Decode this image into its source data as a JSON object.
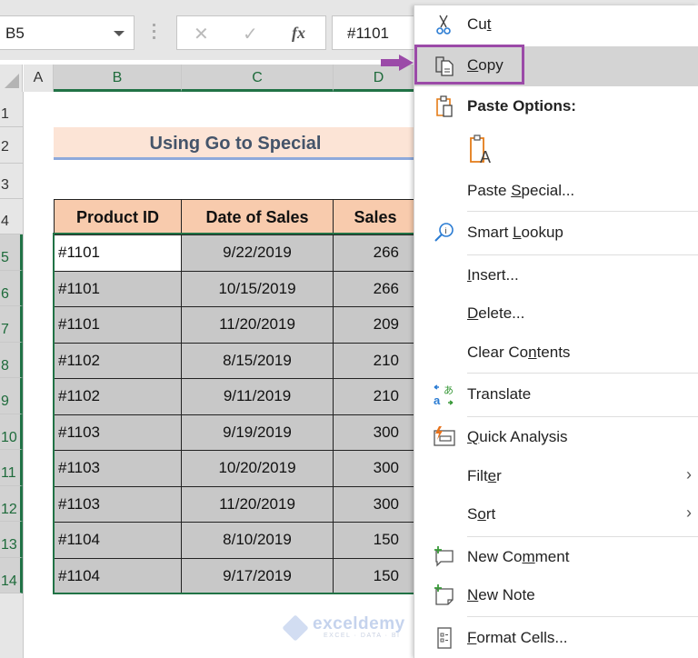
{
  "formula_bar": {
    "name_box": "B5",
    "cancel_icon": "✕",
    "enter_icon": "✓",
    "fx_label": "fx",
    "formula_value": "#1101"
  },
  "columns": [
    "A",
    "B",
    "C",
    "D"
  ],
  "rows": [
    "1",
    "2",
    "3",
    "4",
    "5",
    "6",
    "7",
    "8",
    "9",
    "10",
    "11",
    "12",
    "13",
    "14"
  ],
  "sheet": {
    "title": "Using Go to Special",
    "headers": [
      "Product ID",
      "Date of Sales",
      "Sales"
    ],
    "records": [
      {
        "id": "#1101",
        "date": "9/22/2019",
        "sales": "266"
      },
      {
        "id": "#1101",
        "date": "10/15/2019",
        "sales": "266"
      },
      {
        "id": "#1101",
        "date": "11/20/2019",
        "sales": "209"
      },
      {
        "id": "#1102",
        "date": "8/15/2019",
        "sales": "210"
      },
      {
        "id": "#1102",
        "date": "9/11/2019",
        "sales": "210"
      },
      {
        "id": "#1103",
        "date": "9/19/2019",
        "sales": "300"
      },
      {
        "id": "#1103",
        "date": "10/20/2019",
        "sales": "300"
      },
      {
        "id": "#1103",
        "date": "11/20/2019",
        "sales": "300"
      },
      {
        "id": "#1104",
        "date": "8/10/2019",
        "sales": "150"
      },
      {
        "id": "#1104",
        "date": "9/17/2019",
        "sales": "150"
      }
    ]
  },
  "watermark": {
    "name": "exceldemy",
    "tagline": "EXCEL · DATA · BI"
  },
  "context_menu": {
    "cut": {
      "pre": "Cu",
      "key": "t",
      "post": ""
    },
    "copy": {
      "pre": "",
      "key": "C",
      "post": "opy"
    },
    "paste_options": "Paste Options:",
    "paste_special": {
      "pre": "Paste ",
      "key": "S",
      "post": "pecial..."
    },
    "smart_lookup": {
      "pre": "Smart ",
      "key": "L",
      "post": "ookup"
    },
    "insert": {
      "pre": "",
      "key": "I",
      "post": "nsert..."
    },
    "delete": {
      "pre": "",
      "key": "D",
      "post": "elete..."
    },
    "clear_contents": {
      "pre": "Clear Co",
      "key": "n",
      "post": "tents"
    },
    "translate": "Translate",
    "quick_analysis": {
      "pre": "",
      "key": "Q",
      "post": "uick Analysis"
    },
    "filter": {
      "pre": "Filt",
      "key": "e",
      "post": "r"
    },
    "sort": {
      "pre": "S",
      "key": "o",
      "post": "rt"
    },
    "new_comment": {
      "pre": "New Co",
      "key": "m",
      "post": "ment"
    },
    "new_note": {
      "pre": "",
      "key": "N",
      "post": "ew Note"
    },
    "format_cells": {
      "pre": "",
      "key": "F",
      "post": "ormat Cells..."
    },
    "submenu_arrow": "›"
  },
  "colors": {
    "excel_green": "#217346",
    "highlight_purple": "#9b4aa8",
    "header_fill": "#f8cbad",
    "title_fill": "#fce4d6"
  }
}
